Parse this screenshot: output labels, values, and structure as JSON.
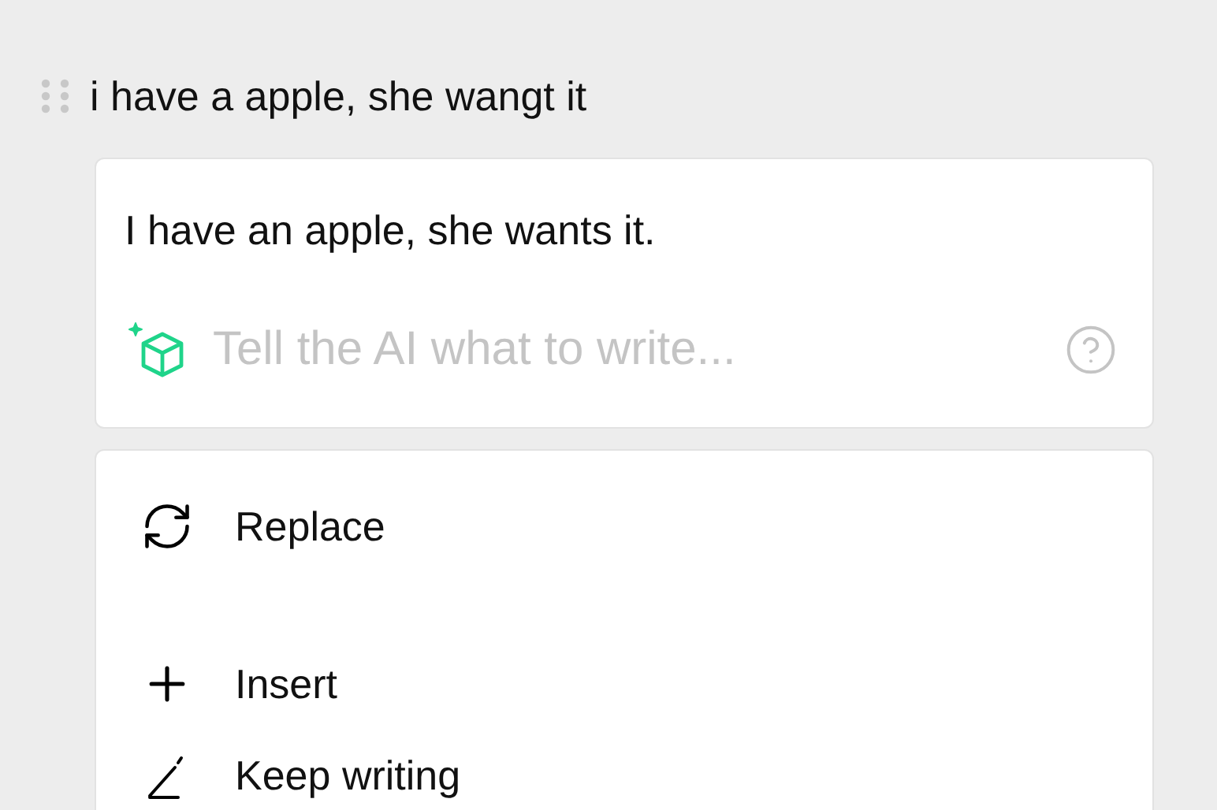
{
  "block": {
    "text": "i have a apple, she wangt it"
  },
  "ai_panel": {
    "result": "I have an apple, she wants it.",
    "prompt": {
      "placeholder": "Tell the AI what to write..."
    }
  },
  "actions": [
    {
      "kind": "replace",
      "label": "Replace"
    },
    {
      "kind": "insert",
      "label": "Insert"
    },
    {
      "kind": "continue",
      "label": "Keep writing"
    }
  ]
}
